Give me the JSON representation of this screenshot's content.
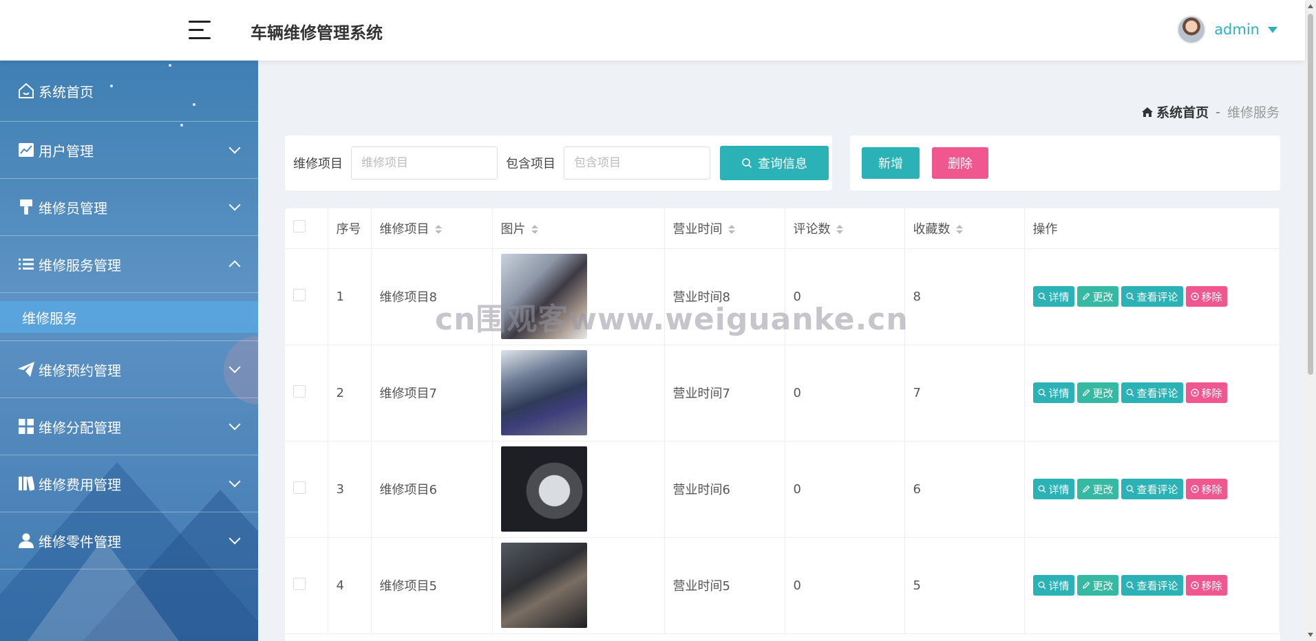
{
  "header": {
    "title": "车辆维修管理系统",
    "user": "admin"
  },
  "sidebar": {
    "items": [
      {
        "label": "系统首页",
        "icon": "home-icon",
        "expandable": false
      },
      {
        "label": "用户管理",
        "icon": "chart-icon",
        "expandable": true
      },
      {
        "label": "维修员管理",
        "icon": "brush-icon",
        "expandable": true
      },
      {
        "label": "维修服务管理",
        "icon": "list-icon",
        "expandable": true,
        "expanded": true
      },
      {
        "label": "维修预约管理",
        "icon": "paper-plane-icon",
        "expandable": true
      },
      {
        "label": "维修分配管理",
        "icon": "grid-icon",
        "expandable": true
      },
      {
        "label": "维修费用管理",
        "icon": "book-icon",
        "expandable": true
      },
      {
        "label": "维修零件管理",
        "icon": "user-icon",
        "expandable": true
      }
    ],
    "submenu": {
      "label": "维修服务"
    }
  },
  "breadcrumb": {
    "home": "系统首页",
    "separator": "-",
    "current": "维修服务"
  },
  "search": {
    "item_label": "维修项目",
    "item_placeholder": "维修项目",
    "contains_label": "包含项目",
    "contains_placeholder": "包含项目",
    "button": "查询信息"
  },
  "actions": {
    "add": "新增",
    "delete": "删除"
  },
  "table": {
    "headers": {
      "index": "序号",
      "item": "维修项目",
      "image": "图片",
      "hours": "营业时间",
      "comments": "评论数",
      "favorites": "收藏数",
      "ops": "操作"
    },
    "ops": {
      "detail": "详情",
      "edit": "更改",
      "view_comments": "查看评论",
      "remove": "移除"
    },
    "rows": [
      {
        "index": "1",
        "item": "维修项目8",
        "hours": "营业时间8",
        "comments": "0",
        "favorites": "8"
      },
      {
        "index": "2",
        "item": "维修项目7",
        "hours": "营业时间7",
        "comments": "0",
        "favorites": "7"
      },
      {
        "index": "3",
        "item": "维修项目6",
        "hours": "营业时间6",
        "comments": "0",
        "favorites": "6"
      },
      {
        "index": "4",
        "item": "维修项目5",
        "hours": "营业时间5",
        "comments": "0",
        "favorites": "5"
      }
    ]
  },
  "watermark": "cn围观客www.weiguanke.cn",
  "colors": {
    "accent": "#2bb2b7",
    "danger": "#f0578e",
    "edit": "#35b9a2"
  }
}
